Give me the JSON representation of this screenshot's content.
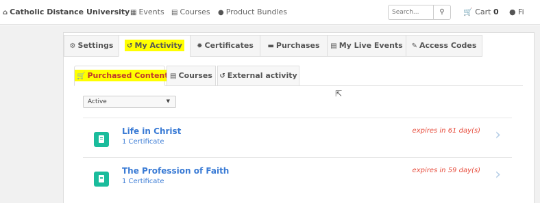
{
  "navbar": {
    "brand": "Catholic Distance University",
    "links": [
      {
        "label": "Events",
        "icon": "calendar-icon"
      },
      {
        "label": "Courses",
        "icon": "book-icon"
      },
      {
        "label": "Product Bundles",
        "icon": "tag-icon"
      }
    ],
    "search_placeholder": "Search...",
    "cart_label": "Cart",
    "cart_count": "0",
    "user_label": "Fi"
  },
  "account_tabs": [
    {
      "label": "Settings",
      "icon": "gear-icon",
      "active": false
    },
    {
      "label": "My Activity",
      "icon": "history-icon",
      "active": true
    },
    {
      "label": "Certificates",
      "icon": "certificate-icon",
      "active": false
    },
    {
      "label": "Purchases",
      "icon": "credit-card-icon",
      "active": false
    },
    {
      "label": "My Live Events",
      "icon": "live-events-icon",
      "active": false
    },
    {
      "label": "Access Codes",
      "icon": "edit-icon",
      "active": false
    }
  ],
  "activity_tabs": [
    {
      "label": "Purchased Content",
      "icon": "cart-icon",
      "active": true
    },
    {
      "label": "Courses",
      "icon": "book-icon",
      "active": false
    },
    {
      "label": "External activity",
      "icon": "history-icon",
      "active": false
    }
  ],
  "filter": {
    "selected": "Active"
  },
  "items": [
    {
      "title": "Life in Christ",
      "subtitle": "1 Certificate",
      "expiry": "expires in 61 day(s)"
    },
    {
      "title": "The Profession of Faith",
      "subtitle": "1 Certificate",
      "expiry": "expires in 59 day(s)"
    }
  ],
  "colors": {
    "highlight": "#ffff00",
    "link": "#3a7bd5",
    "expiry": "#e74c3c",
    "item_icon": "#1abc9c"
  }
}
